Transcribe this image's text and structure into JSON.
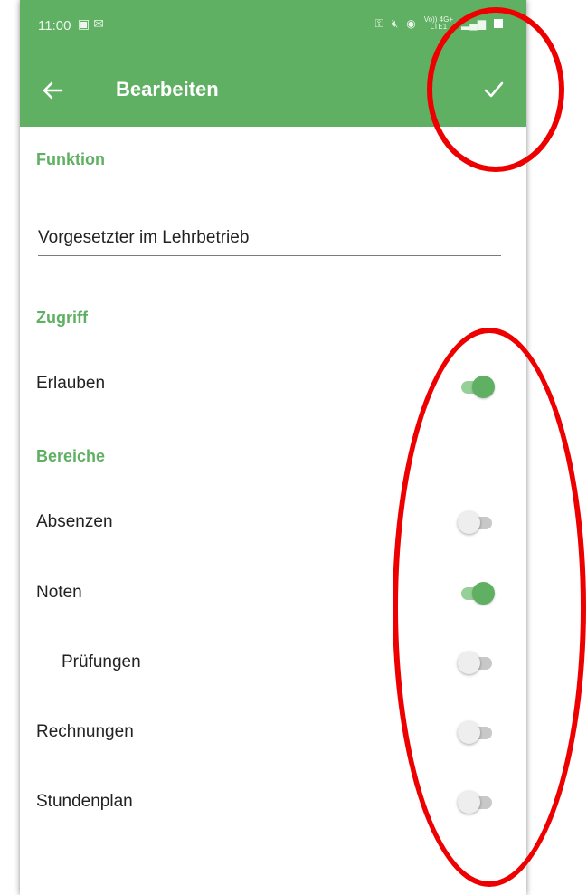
{
  "status_bar": {
    "time": "11:00",
    "left_icons": "gallery-icon mail-icon",
    "network": "Vo)) 4G+",
    "network_sub": "LTE1"
  },
  "app_bar": {
    "title": "Bearbeiten",
    "back_icon": "arrow-left-icon",
    "confirm_icon": "check-icon"
  },
  "function_section": {
    "header": "Funktion",
    "field_value": "Vorgesetzter im Lehrbetrieb"
  },
  "access_section": {
    "header": "Zugriff",
    "items": [
      {
        "label": "Erlauben",
        "on": true
      }
    ]
  },
  "areas_section": {
    "header": "Bereiche",
    "items": [
      {
        "label": "Absenzen",
        "on": false
      },
      {
        "label": "Noten",
        "on": true
      },
      {
        "label": "Prüfungen",
        "on": false,
        "indented": true
      },
      {
        "label": "Rechnungen",
        "on": false
      },
      {
        "label": "Stundenplan",
        "on": false
      }
    ]
  },
  "colors": {
    "primary": "#5fb063",
    "annotation": "#ee0000"
  }
}
